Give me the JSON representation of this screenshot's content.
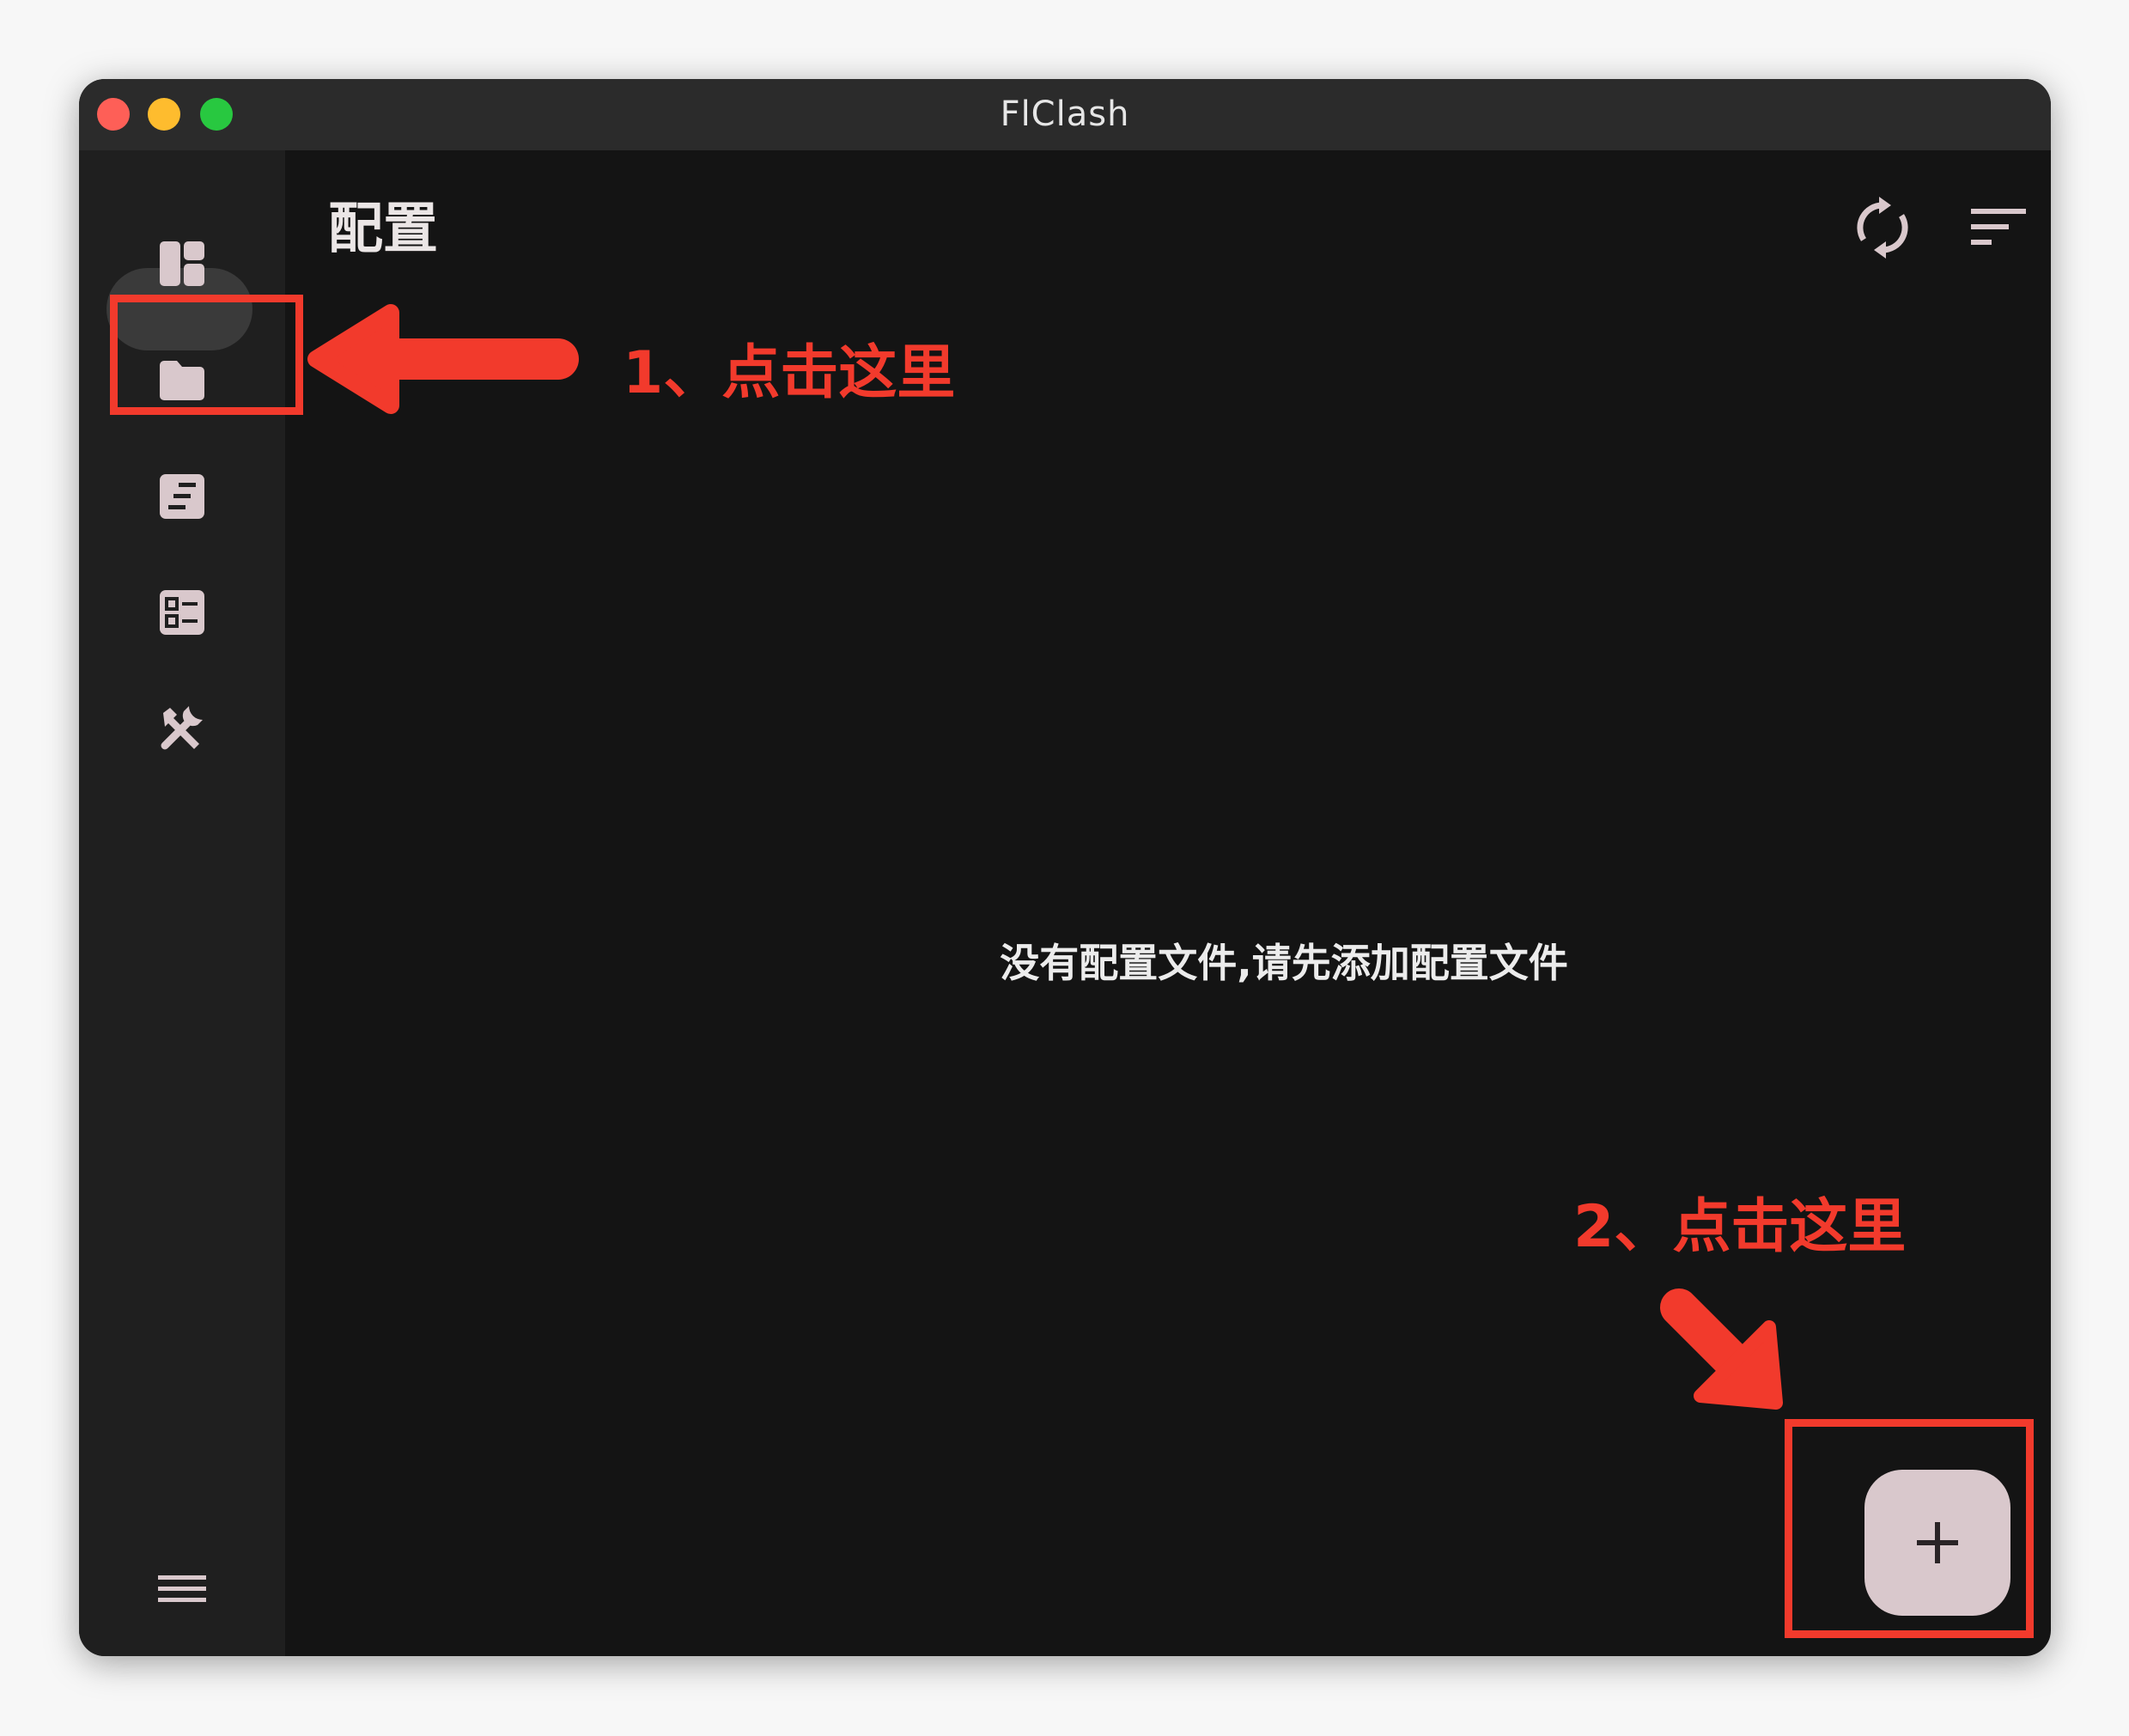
{
  "window": {
    "title": "FlClash"
  },
  "colors": {
    "accent": "#d9c8cc",
    "annotation": "#f23a2c",
    "background": "#141414",
    "sidebar": "#1f1f1f"
  },
  "sidebar": {
    "items": [
      {
        "id": "dashboard",
        "icon": "dashboard-icon"
      },
      {
        "id": "profiles",
        "icon": "folder-icon",
        "active": true
      },
      {
        "id": "logs",
        "icon": "document-icon"
      },
      {
        "id": "resources",
        "icon": "list-icon"
      },
      {
        "id": "tools",
        "icon": "tools-icon"
      }
    ],
    "menu_icon": "menu-icon"
  },
  "header": {
    "title": "配置",
    "actions": [
      {
        "id": "sync",
        "icon": "sync-icon"
      },
      {
        "id": "sort",
        "icon": "sort-icon"
      }
    ]
  },
  "main": {
    "empty_message": "没有配置文件,请先添加配置文件"
  },
  "fab": {
    "icon": "plus-icon"
  },
  "annotations": {
    "step1": "1、点击这里",
    "step2": "2、点击这里"
  }
}
